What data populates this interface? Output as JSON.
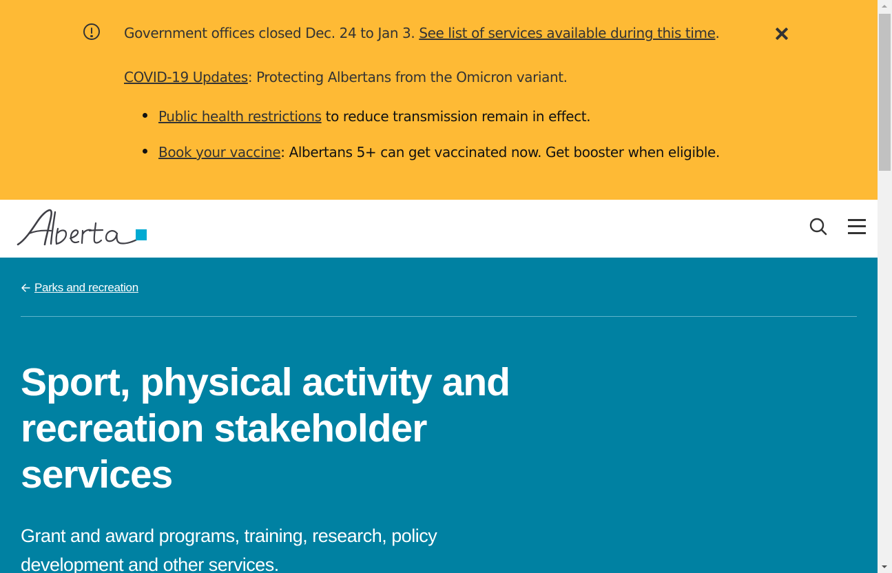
{
  "alert": {
    "icon": "alert-circle-icon",
    "line1_text": "Government offices closed Dec. 24 to Jan 3.",
    "line1_link": "See list of services available during this time",
    "line1_end": ".",
    "line2_link": "COVID-19 Updates",
    "line2_text": ": Protecting Albertans from the Omicron variant.",
    "bullets": [
      {
        "link": "Public health restrictions",
        "text": " to reduce transmission remain in effect."
      },
      {
        "link": "Book your vaccine",
        "text": ": Albertans 5+ can get vaccinated now. Get booster when eligible."
      }
    ],
    "close_icon": "close-icon",
    "background": "#FEBA35"
  },
  "header": {
    "logo_text": "Alberta",
    "logo_accent": "#00AAD2",
    "search_icon": "search-icon",
    "menu_icon": "menu-icon"
  },
  "hero": {
    "breadcrumb": "Parks and recreation",
    "title": "Sport, physical activity and recreation stakeholder services",
    "lead": "Grant and award programs, training, research, policy development and other services.",
    "background": "#0081A2"
  }
}
